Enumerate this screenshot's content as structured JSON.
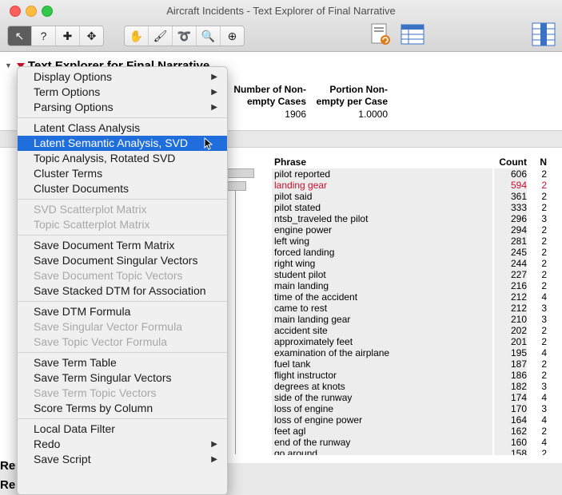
{
  "window": {
    "title": "Aircraft Incidents - Text Explorer of Final Narrative"
  },
  "report": {
    "title": "Text Explorer for Final Narrative",
    "summary_headers": [
      "Number of Non-\nempty Cases",
      "Portion Non-\nempty per Case"
    ],
    "summary_values": [
      "1906",
      "1.0000"
    ],
    "below_labels": [
      "Re",
      "Re"
    ]
  },
  "menu": {
    "items": [
      {
        "label": "Display Options",
        "submenu": true
      },
      {
        "label": "Term Options",
        "submenu": true
      },
      {
        "label": "Parsing Options",
        "submenu": true
      },
      {
        "sep": true
      },
      {
        "label": "Latent Class Analysis"
      },
      {
        "label": "Latent Semantic Analysis, SVD",
        "highlight": true
      },
      {
        "label": "Topic Analysis, Rotated SVD"
      },
      {
        "label": "Cluster Terms"
      },
      {
        "label": "Cluster Documents"
      },
      {
        "sep": true
      },
      {
        "label": "SVD Scatterplot Matrix",
        "disabled": true
      },
      {
        "label": "Topic Scatterplot Matrix",
        "disabled": true
      },
      {
        "sep": true
      },
      {
        "label": "Save Document Term Matrix"
      },
      {
        "label": "Save Document Singular Vectors"
      },
      {
        "label": "Save Document Topic Vectors",
        "disabled": true
      },
      {
        "label": "Save Stacked DTM for Association"
      },
      {
        "sep": true
      },
      {
        "label": "Save DTM Formula"
      },
      {
        "label": "Save Singular Vector Formula",
        "disabled": true
      },
      {
        "label": "Save Topic Vector Formula",
        "disabled": true
      },
      {
        "sep": true
      },
      {
        "label": "Save Term Table"
      },
      {
        "label": "Save Term Singular Vectors"
      },
      {
        "label": "Save Term Topic Vectors",
        "disabled": true
      },
      {
        "label": "Score Terms by Column"
      },
      {
        "sep": true
      },
      {
        "label": "Local Data Filter"
      },
      {
        "label": "Redo",
        "submenu": true
      },
      {
        "label": "Save Script",
        "submenu": true
      }
    ]
  },
  "phrases": {
    "headers": {
      "phrase": "Phrase",
      "count": "Count",
      "n": "N"
    },
    "rows": [
      {
        "phrase": "pilot reported",
        "count": "606",
        "n": "2"
      },
      {
        "phrase": "landing gear",
        "count": "594",
        "n": "2",
        "selected": true
      },
      {
        "phrase": "pilot said",
        "count": "361",
        "n": "2"
      },
      {
        "phrase": "pilot stated",
        "count": "333",
        "n": "2"
      },
      {
        "phrase": "ntsb_traveled the pilot",
        "count": "296",
        "n": "3"
      },
      {
        "phrase": "engine power",
        "count": "294",
        "n": "2"
      },
      {
        "phrase": "left wing",
        "count": "281",
        "n": "2"
      },
      {
        "phrase": "forced landing",
        "count": "245",
        "n": "2"
      },
      {
        "phrase": "right wing",
        "count": "244",
        "n": "2"
      },
      {
        "phrase": "student pilot",
        "count": "227",
        "n": "2"
      },
      {
        "phrase": "main landing",
        "count": "216",
        "n": "2"
      },
      {
        "phrase": "time of the accident",
        "count": "212",
        "n": "4"
      },
      {
        "phrase": "came to rest",
        "count": "212",
        "n": "3"
      },
      {
        "phrase": "main landing gear",
        "count": "210",
        "n": "3"
      },
      {
        "phrase": "accident site",
        "count": "202",
        "n": "2"
      },
      {
        "phrase": "approximately feet",
        "count": "201",
        "n": "2"
      },
      {
        "phrase": "examination of the airplane",
        "count": "195",
        "n": "4"
      },
      {
        "phrase": "fuel tank",
        "count": "187",
        "n": "2"
      },
      {
        "phrase": "flight instructor",
        "count": "186",
        "n": "2"
      },
      {
        "phrase": "degrees at knots",
        "count": "182",
        "n": "3"
      },
      {
        "phrase": "side of the runway",
        "count": "174",
        "n": "4"
      },
      {
        "phrase": "loss of engine",
        "count": "170",
        "n": "3"
      },
      {
        "phrase": "loss of engine power",
        "count": "164",
        "n": "4"
      },
      {
        "phrase": "feet agl",
        "count": "162",
        "n": "2"
      },
      {
        "phrase": "end of the runway",
        "count": "160",
        "n": "4"
      },
      {
        "phrase": "go around",
        "count": "158",
        "n": "2"
      }
    ]
  }
}
